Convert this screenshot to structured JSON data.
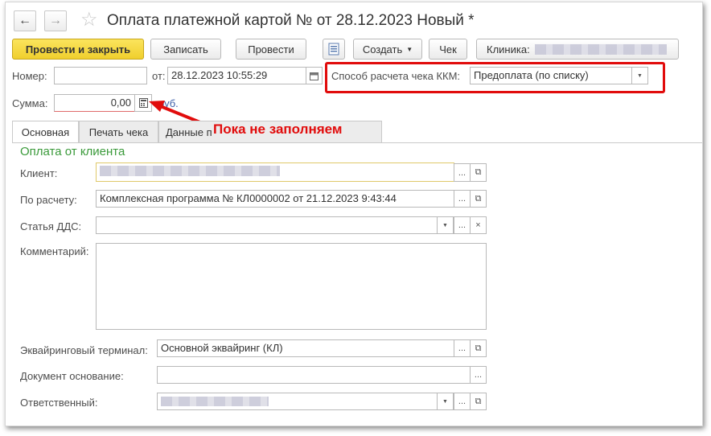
{
  "title": "Оплата платежной картой №  от 28.12.2023 Новый *",
  "nav": {
    "back": "←",
    "forward": "→",
    "star": "☆"
  },
  "toolbar": {
    "post_close": "Провести и закрыть",
    "save": "Записать",
    "post": "Провести",
    "create": "Создать",
    "check": "Чек",
    "clinic_label": "Клиника:"
  },
  "header": {
    "number_label": "Номер:",
    "number_value": "",
    "date_label": "от:",
    "date_value": "28.12.2023 10:55:29",
    "payment_method_label": "Способ расчета чека ККМ:",
    "payment_method_value": "Предоплата (по списку)",
    "sum_label": "Сумма:",
    "sum_value": "0,00",
    "currency": "руб."
  },
  "annotation": "Пока не заполняем",
  "tabs": [
    "Основная",
    "Печать чека",
    "Данные п"
  ],
  "section_title": "Оплата от клиента",
  "form": {
    "client_label": "Клиент:",
    "settlement_label": "По расчету:",
    "settlement_value": "Комплексная программа № КЛ0000002 от 21.12.2023 9:43:44",
    "dds_label": "Статья ДДС:",
    "dds_value": "",
    "comment_label": "Комментарий:",
    "comment_value": "",
    "terminal_label": "Эквайринговый терминал:",
    "terminal_value": "Основной эквайринг (КЛ)",
    "basis_label": "Документ основание:",
    "basis_value": "",
    "responsible_label": "Ответственный:"
  },
  "colors": {
    "primary_button": "#f5d73c",
    "accent_green": "#3a9a3a",
    "annotation_red": "#e10c0c",
    "link_blue": "#3b5ea8"
  }
}
